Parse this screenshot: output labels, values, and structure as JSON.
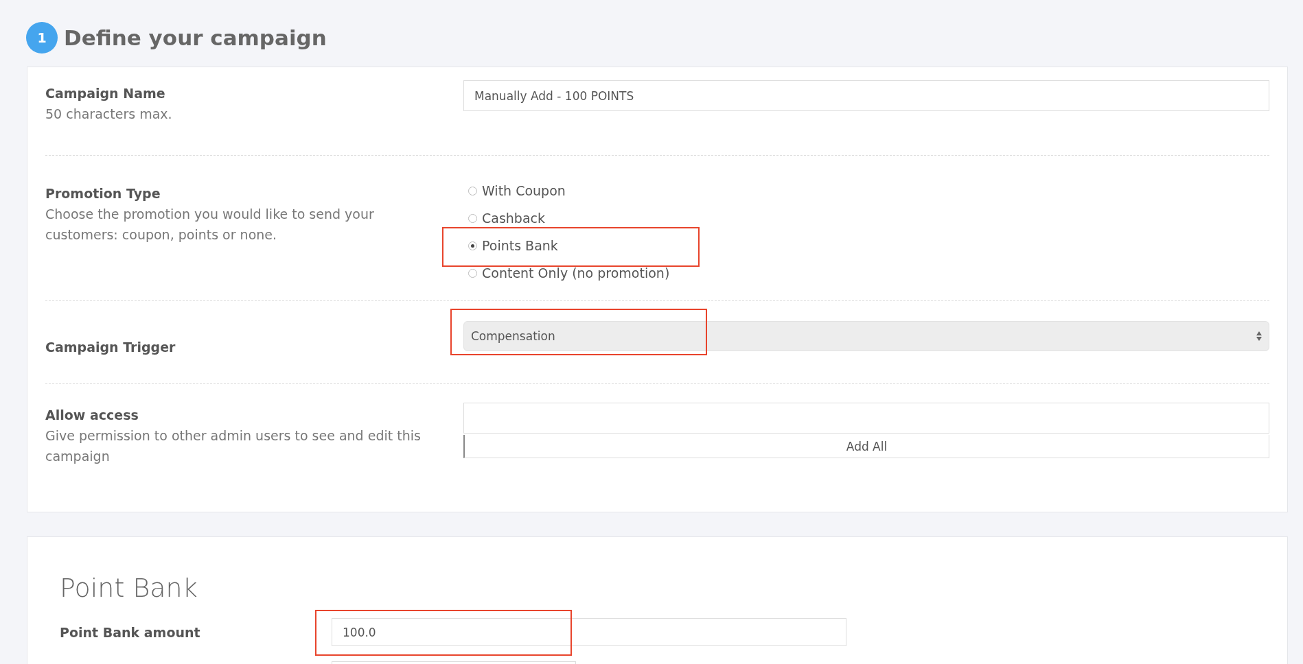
{
  "step": {
    "number": "1",
    "title": "Define your campaign"
  },
  "campaign_name": {
    "label": "Campaign Name",
    "hint": "50 characters max.",
    "value": "Manually Add - 100 POINTS"
  },
  "promotion_type": {
    "label": "Promotion Type",
    "hint": "Choose the promotion you would like to send your customers: coupon, points or none.",
    "options": [
      {
        "label": "With Coupon",
        "selected": false
      },
      {
        "label": "Cashback",
        "selected": false
      },
      {
        "label": "Points Bank",
        "selected": true
      },
      {
        "label": "Content Only (no promotion)",
        "selected": false
      }
    ]
  },
  "campaign_trigger": {
    "label": "Campaign Trigger",
    "value": "Compensation"
  },
  "allow_access": {
    "label": "Allow access",
    "hint": "Give permission to other admin users to see and edit this campaign",
    "button": "Add All"
  },
  "point_bank": {
    "title": "Point Bank",
    "amount_label": "Point Bank amount",
    "amount_value": "100.0"
  }
}
